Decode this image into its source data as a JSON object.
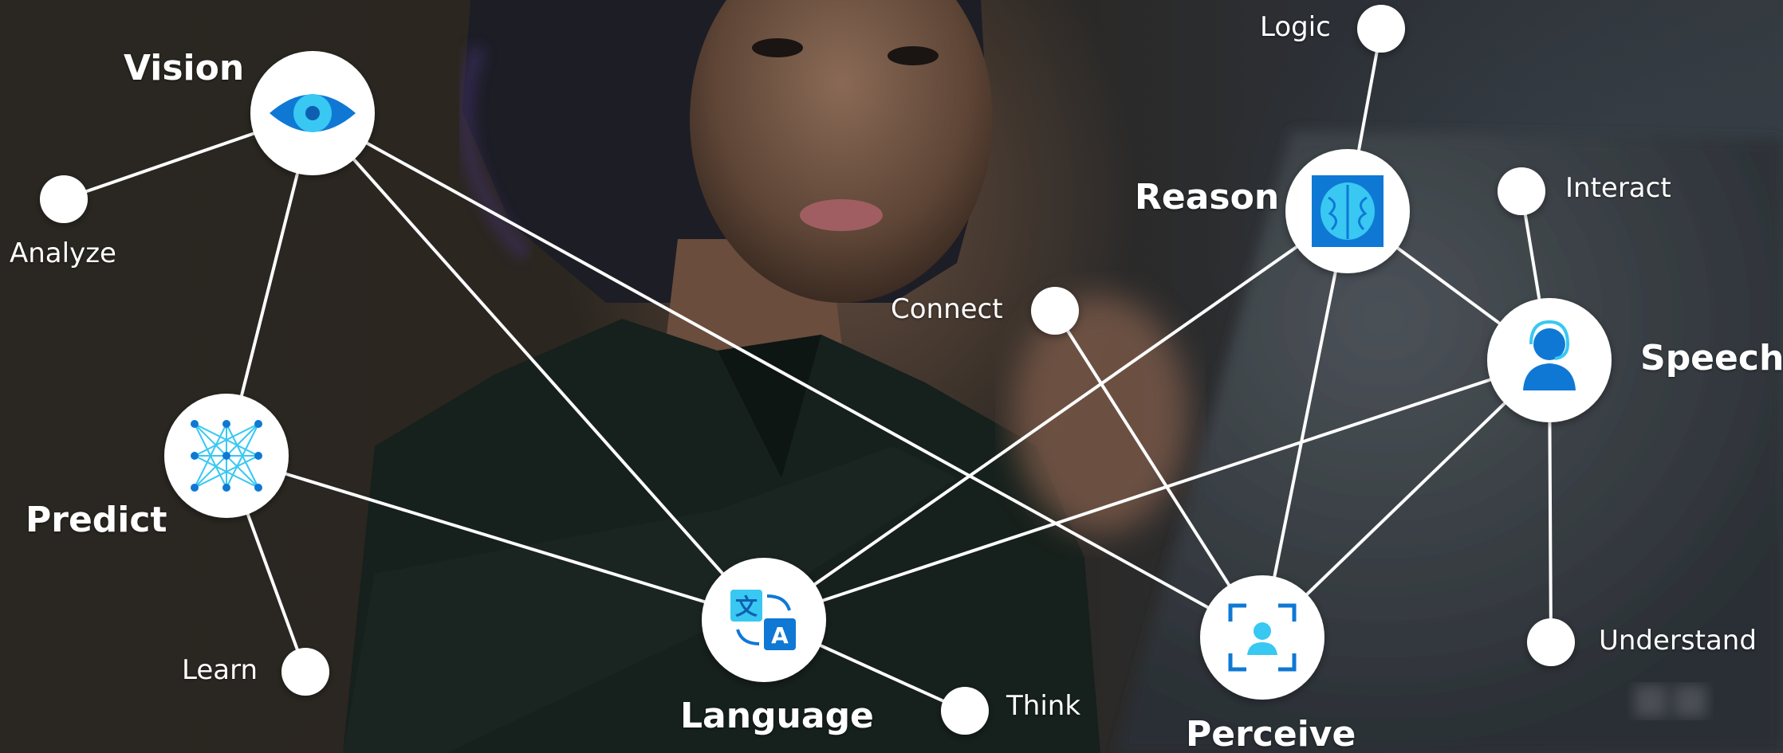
{
  "labels": {
    "vision": "Vision",
    "analyze": "Analyze",
    "predict": "Predict",
    "learn": "Learn",
    "language": "Language",
    "think": "Think",
    "connect": "Connect",
    "logic": "Logic",
    "reason": "Reason",
    "interact": "Interact",
    "speech": "Speech",
    "perceive": "Perceive",
    "understand": "Understand"
  },
  "colors": {
    "node_fill": "#ffffff",
    "connector": "#ffffff",
    "icon_blue": "#0f78d4",
    "icon_light_blue": "#38c8f2"
  }
}
